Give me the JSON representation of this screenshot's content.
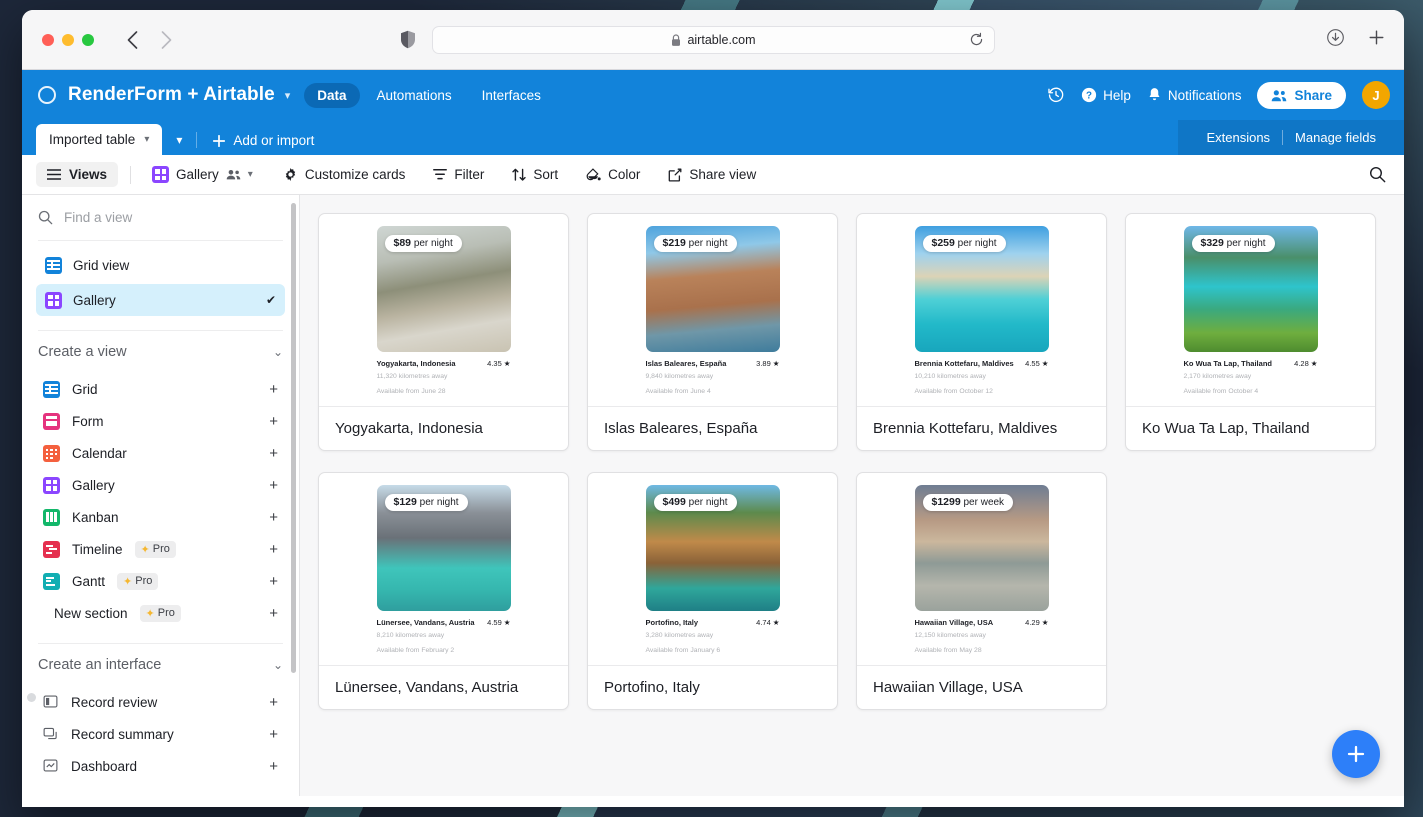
{
  "browser": {
    "url": "airtable.com",
    "lock_icon": "lock-icon",
    "shield_icon": "shield-icon",
    "reload_icon": "reload-icon",
    "back_icon": "back-arrow-icon",
    "forward_icon": "forward-arrow-icon",
    "downloads_icon": "downloads-icon",
    "new_tab_icon": "plus-icon"
  },
  "header": {
    "base_name": "RenderForm + Airtable",
    "base_icon": "circle-icon",
    "caret_icon": "chevron-down-icon",
    "tabs": [
      {
        "label": "Data",
        "active": true
      },
      {
        "label": "Automations",
        "active": false
      },
      {
        "label": "Interfaces",
        "active": false
      }
    ],
    "history_icon": "history-clock-icon",
    "help_label": "Help",
    "help_icon": "question-circle-icon",
    "notifications_label": "Notifications",
    "notifications_icon": "bell-icon",
    "share_label": "Share",
    "share_icon": "people-icon",
    "avatar_initial": "J",
    "avatar_color": "#f2a600",
    "brand_color": "#1283da"
  },
  "table_bar": {
    "active_table": "Imported table",
    "table_caret_icon": "chevron-down-icon",
    "expand_caret_icon": "chevron-down-icon",
    "add_or_import": "Add or import",
    "add_icon": "plus-icon",
    "extensions": "Extensions",
    "manage_fields": "Manage fields"
  },
  "toolbar": {
    "views_label": "Views",
    "views_icon": "hamburger-icon",
    "view_name": "Gallery",
    "view_icon": "gallery-view-icon",
    "collaborators_icon": "people-icon",
    "view_caret_icon": "chevron-down-icon",
    "customize_cards": "Customize cards",
    "customize_icon": "gear-icon",
    "filter": "Filter",
    "filter_icon": "funnel-icon",
    "sort": "Sort",
    "sort_icon": "sort-arrows-icon",
    "color": "Color",
    "color_icon": "paint-drop-icon",
    "share_view": "Share view",
    "share_view_icon": "share-box-icon",
    "search_icon": "search-icon"
  },
  "sidebar": {
    "search_placeholder": "Find a view",
    "search_value": "",
    "search_icon": "search-icon",
    "views": [
      {
        "label": "Grid view",
        "icon": "grid-view-icon",
        "selected": false,
        "check_icon": ""
      },
      {
        "label": "Gallery",
        "icon": "gallery-view-icon",
        "selected": true,
        "check_icon": "check-icon"
      }
    ],
    "create_a_view": {
      "title": "Create a view",
      "chevron_icon": "chevron-down-icon",
      "items": [
        {
          "label": "Grid",
          "icon": "grid-view-icon",
          "pro": false,
          "add_icon": "plus-icon"
        },
        {
          "label": "Form",
          "icon": "form-view-icon",
          "pro": false,
          "add_icon": "plus-icon"
        },
        {
          "label": "Calendar",
          "icon": "calendar-view-icon",
          "pro": false,
          "add_icon": "plus-icon"
        },
        {
          "label": "Gallery",
          "icon": "gallery-view-icon",
          "pro": false,
          "add_icon": "plus-icon"
        },
        {
          "label": "Kanban",
          "icon": "kanban-view-icon",
          "pro": false,
          "add_icon": "plus-icon"
        },
        {
          "label": "Timeline",
          "icon": "timeline-view-icon",
          "pro": true,
          "add_icon": "plus-icon"
        },
        {
          "label": "Gantt",
          "icon": "gantt-view-icon",
          "pro": true,
          "add_icon": "plus-icon"
        },
        {
          "label": "New section",
          "icon": "",
          "pro": true,
          "add_icon": "plus-icon"
        }
      ],
      "pro_badge_label": "Pro",
      "pro_badge_icon": "sparkle-icon"
    },
    "create_an_interface": {
      "title": "Create an interface",
      "chevron_icon": "chevron-down-icon",
      "items": [
        {
          "label": "Record review",
          "icon": "record-review-icon",
          "add_icon": "plus-icon"
        },
        {
          "label": "Record summary",
          "icon": "record-summary-icon",
          "add_icon": "plus-icon"
        },
        {
          "label": "Dashboard",
          "icon": "dashboard-icon",
          "add_icon": "plus-icon"
        }
      ]
    }
  },
  "gallery": {
    "add_record_icon": "plus-icon",
    "cards": [
      {
        "title": "Yogyakarta, Indonesia",
        "price": "$89",
        "price_unit": "per night",
        "listing_title": "Yogyakarta, Indonesia",
        "rating": "4.35",
        "star_icon": "star-icon",
        "distance": "11,320 kilometres away",
        "availability": "Available from June 28",
        "photo": "ph1"
      },
      {
        "title": "Islas Baleares, España",
        "price": "$219",
        "price_unit": "per night",
        "listing_title": "Islas Baleares, España",
        "rating": "3.89",
        "star_icon": "star-icon",
        "distance": "9,840 kilometres away",
        "availability": "Available from June 4",
        "photo": "ph2"
      },
      {
        "title": "Brennia Kottefaru, Maldives",
        "price": "$259",
        "price_unit": "per night",
        "listing_title": "Brennia Kottefaru, Maldives",
        "rating": "4.55",
        "star_icon": "star-icon",
        "distance": "10,210 kilometres away",
        "availability": "Available from October 12",
        "photo": "ph3"
      },
      {
        "title": "Ko Wua Ta Lap, Thailand",
        "price": "$329",
        "price_unit": "per night",
        "listing_title": "Ko Wua Ta Lap, Thailand",
        "rating": "4.28",
        "star_icon": "star-icon",
        "distance": "2,170 kilometres away",
        "availability": "Available from October 4",
        "photo": "ph4"
      },
      {
        "title": "Lünersee, Vandans, Austria",
        "price": "$129",
        "price_unit": "per night",
        "listing_title": "Lünersee, Vandans, Austria",
        "rating": "4.59",
        "star_icon": "star-icon",
        "distance": "8,210 kilometres away",
        "availability": "Available from February 2",
        "photo": "ph5"
      },
      {
        "title": "Portofino, Italy",
        "price": "$499",
        "price_unit": "per night",
        "listing_title": "Portofino, Italy",
        "rating": "4.74",
        "star_icon": "star-icon",
        "distance": "3,280 kilometres away",
        "availability": "Available from January 6",
        "photo": "ph6"
      },
      {
        "title": "Hawaiian Village, USA",
        "price": "$1299",
        "price_unit": "per week",
        "listing_title": "Hawaiian Village, USA",
        "rating": "4.29",
        "star_icon": "star-icon",
        "distance": "12,150 kilometres away",
        "availability": "Available from May 28",
        "photo": "ph7"
      }
    ]
  }
}
